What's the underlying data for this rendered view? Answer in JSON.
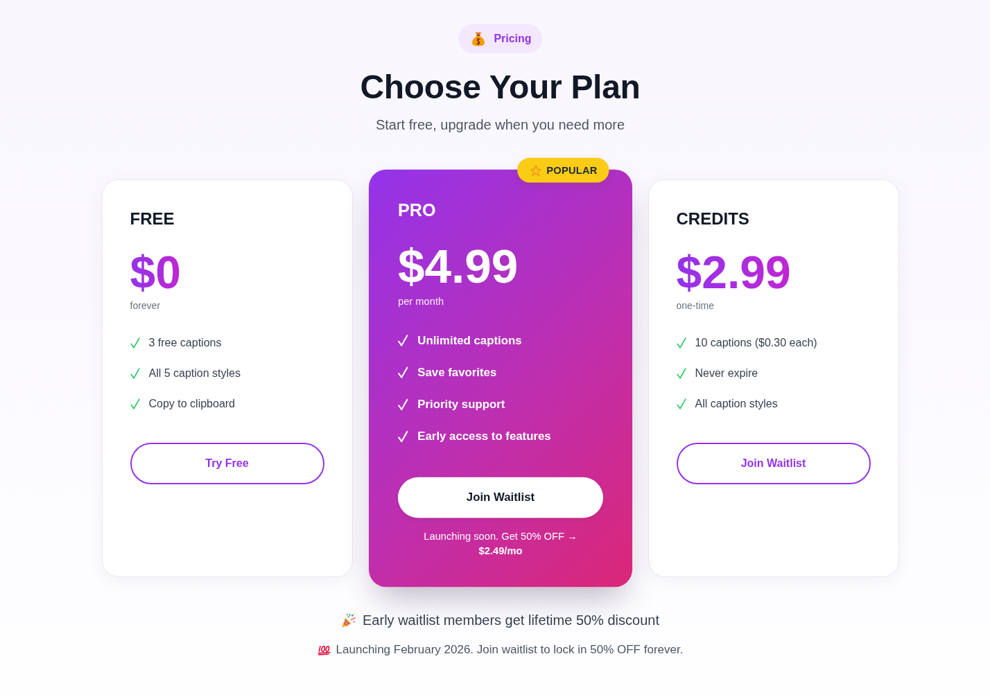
{
  "header": {
    "badge": "Pricing",
    "title": "Choose Your Plan",
    "subtitle": "Start free, upgrade when you need more"
  },
  "plans": [
    {
      "name": "FREE",
      "price": "$0",
      "period": "forever",
      "featured": false,
      "features": [
        "3 free captions",
        "All 5 caption styles",
        "Copy to clipboard"
      ],
      "button": "Try Free"
    },
    {
      "name": "PRO",
      "badge": "POPULAR",
      "price": "$4.99",
      "period": "per month",
      "featured": true,
      "features": [
        "Unlimited captions",
        "Save favorites",
        "Priority support",
        "Early access to features"
      ],
      "button": "Join Waitlist",
      "note": "Launching soon. Get 50% OFF → **$2.49/mo**"
    },
    {
      "name": "CREDITS",
      "price": "$2.99",
      "period": "one-time",
      "featured": false,
      "features": [
        "10 captions ($0.30 each)",
        "Never expire",
        "All caption styles"
      ],
      "button": "Join Waitlist"
    }
  ],
  "footer": {
    "headline": "Early waitlist members get lifetime 50% discount",
    "note": "Launching February 2026. Join waitlist to lock in 50% OFF forever."
  }
}
